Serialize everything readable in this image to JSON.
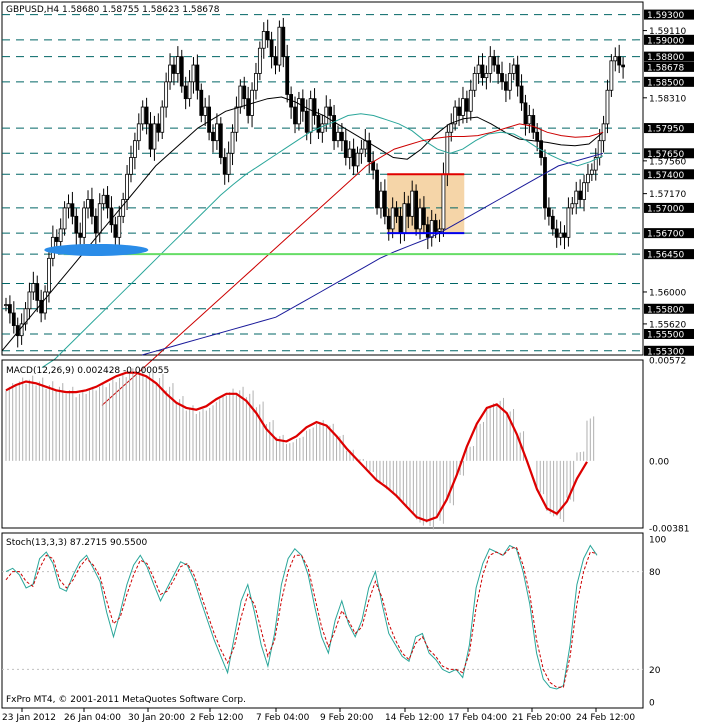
{
  "chart_data": [
    {
      "type": "candlestick",
      "title": "GBPUSD,H4  1.58680 1.58755 1.58623 1.58678",
      "ylim": [
        1.5525,
        1.5945
      ],
      "y_ticks": [
        "1.59300",
        "1.59110",
        "1.59000",
        "1.58800",
        "1.58678",
        "1.58500",
        "1.58310",
        "1.57950",
        "1.57650",
        "1.57560",
        "1.57400",
        "1.57170",
        "1.57000",
        "1.56700",
        "1.56450",
        "1.56000",
        "1.55800",
        "1.55620",
        "1.55500",
        "1.55300"
      ],
      "horizontal_levels": [
        1.593,
        1.59,
        1.588,
        1.585,
        1.5795,
        1.5765,
        1.574,
        1.57,
        1.567,
        1.5645,
        1.561,
        1.558,
        1.555,
        1.553
      ],
      "current_price": 1.58678,
      "highlighted_levels": [
        1.593,
        1.59,
        1.588,
        1.585,
        1.5795,
        1.5765,
        1.574,
        1.57,
        1.567,
        1.5645,
        1.561,
        1.558,
        1.555,
        1.553
      ],
      "close": [
        1.5585,
        1.5575,
        1.556,
        1.5548,
        1.5562,
        1.558,
        1.56,
        1.561,
        1.559,
        1.5575,
        1.56,
        1.564,
        1.5665,
        1.566,
        1.5675,
        1.57,
        1.5705,
        1.569,
        1.567,
        1.5665,
        1.57,
        1.571,
        1.569,
        1.567,
        1.5705,
        1.5715,
        1.57,
        1.568,
        1.5665,
        1.569,
        1.571,
        1.574,
        1.576,
        1.578,
        1.58,
        1.582,
        1.58,
        1.577,
        1.58,
        1.579,
        1.582,
        1.585,
        1.587,
        1.586,
        1.588,
        1.5845,
        1.583,
        1.585,
        1.587,
        1.584,
        1.581,
        1.582,
        1.579,
        1.578,
        1.58,
        1.576,
        1.574,
        1.5765,
        1.579,
        1.582,
        1.5845,
        1.583,
        1.581,
        1.584,
        1.586,
        1.589,
        1.591,
        1.59,
        1.588,
        1.587,
        1.5915,
        1.588,
        1.5835,
        1.582,
        1.58,
        1.583,
        1.5815,
        1.579,
        1.583,
        1.581,
        1.579,
        1.58,
        1.582,
        1.581,
        1.578,
        1.579,
        1.578,
        1.576,
        1.577,
        1.575,
        1.5765,
        1.577,
        1.578,
        1.5755,
        1.5745,
        1.57,
        1.572,
        1.569,
        1.5675,
        1.57,
        1.569,
        1.567,
        1.5705,
        1.569,
        1.572,
        1.5675,
        1.57,
        1.568,
        1.5665,
        1.5685,
        1.5672,
        1.5675,
        1.574,
        1.579,
        1.58,
        1.582,
        1.581,
        1.583,
        1.5815,
        1.584,
        1.586,
        1.587,
        1.5855,
        1.586,
        1.588,
        1.587,
        1.586,
        1.585,
        1.584,
        1.586,
        1.587,
        1.5845,
        1.5825,
        1.58,
        1.581,
        1.579,
        1.578,
        1.576,
        1.57,
        1.569,
        1.5675,
        1.5665,
        1.567,
        1.5665,
        1.57,
        1.5705,
        1.572,
        1.571,
        1.573,
        1.574,
        1.5745,
        1.576,
        1.578,
        1.58,
        1.584,
        1.5875,
        1.588,
        1.587,
        1.58678
      ],
      "overlay_lines": [
        {
          "color": "#000000",
          "values": [
            1.553,
            1.555,
            1.557,
            1.559,
            1.561,
            1.563,
            1.565,
            1.567,
            1.569,
            1.571,
            1.573,
            1.575,
            1.5765,
            1.578,
            1.5795,
            1.5805,
            1.5815,
            1.582,
            1.5825,
            1.583,
            1.5832,
            1.5826,
            1.5817,
            1.581,
            1.58,
            1.579,
            1.578,
            1.577,
            1.576,
            1.5758,
            1.577,
            1.5787,
            1.58,
            1.5806,
            1.5808,
            1.58,
            1.579,
            1.5782,
            1.578,
            1.5778,
            1.5775,
            1.5774,
            1.5776,
            1.579
          ]
        },
        {
          "color": "#2aa69a",
          "values": [
            1.551,
            1.552,
            1.5535,
            1.555,
            1.5565,
            1.558,
            1.5595,
            1.561,
            1.5625,
            1.564,
            1.5655,
            1.567,
            1.5685,
            1.57,
            1.5715,
            1.5728,
            1.574,
            1.575,
            1.576,
            1.577,
            1.578,
            1.579,
            1.5797,
            1.5803,
            1.581,
            1.5812,
            1.581,
            1.5805,
            1.58,
            1.5792,
            1.578,
            1.577,
            1.5765,
            1.577,
            1.578,
            1.5788,
            1.579,
            1.5788,
            1.578,
            1.577,
            1.5762,
            1.5755,
            1.575,
            1.5755,
            1.5762
          ]
        },
        {
          "color": "#cc0000",
          "values": [
            1.5465,
            1.548,
            1.5495,
            1.551,
            1.5525,
            1.554,
            1.5555,
            1.557,
            1.5585,
            1.56,
            1.5615,
            1.563,
            1.5645,
            1.566,
            1.5675,
            1.569,
            1.5705,
            1.572,
            1.5735,
            1.575,
            1.576,
            1.577,
            1.5775,
            1.578,
            1.5783,
            1.5785,
            1.5785,
            1.5786,
            1.579,
            1.5795,
            1.58,
            1.5797,
            1.579,
            1.5786,
            1.5784,
            1.5785,
            1.579
          ]
        },
        {
          "color": "#1a1a9a",
          "values": [
            1.5525,
            1.553,
            1.5535,
            1.554,
            1.5545,
            1.555,
            1.5555,
            1.556,
            1.5565,
            1.557,
            1.558,
            1.559,
            1.56,
            1.561,
            1.562,
            1.563,
            1.564,
            1.5648,
            1.5655,
            1.5662,
            1.567,
            1.568,
            1.569,
            1.57,
            1.571,
            1.572,
            1.573,
            1.574,
            1.575,
            1.5755,
            1.576,
            1.5765
          ]
        }
      ],
      "markers": [
        {
          "kind": "box",
          "x_from": 0.625,
          "x_to": 0.75,
          "y_from": 1.567,
          "y_to": 1.574,
          "color": "#f5d5a8"
        },
        {
          "kind": "segment",
          "x_from": 0.625,
          "x_to": 0.75,
          "y": 1.574,
          "color": "#e00000"
        },
        {
          "kind": "segment",
          "x_from": 0.625,
          "x_to": 0.75,
          "y": 1.567,
          "color": "#0000ee"
        },
        {
          "kind": "segment",
          "x_from": 0.1,
          "x_to": 1.04,
          "y": 1.5645,
          "color": "#66dd66"
        },
        {
          "kind": "ellipse",
          "x": 0.14,
          "y": 1.565,
          "color": "#2a8ce8"
        }
      ]
    },
    {
      "type": "histogram+line",
      "title": "MACD(12,26,9) 0.002428 -0.000055",
      "ylim": [
        -0.00381,
        0.00572
      ],
      "y_ticks": [
        "0.00572",
        "0.00",
        "-0.00381"
      ],
      "histogram": [
        0.0042,
        0.0045,
        0.0046,
        0.0045,
        0.0043,
        0.0042,
        0.004,
        0.0038,
        0.004,
        0.0042,
        0.0044,
        0.0047,
        0.005,
        0.0051,
        0.005,
        0.0047,
        0.0042,
        0.0035,
        0.003,
        0.0028,
        0.003,
        0.0035,
        0.0039,
        0.004,
        0.0038,
        0.0032,
        0.0022,
        0.0014,
        0.001,
        0.0013,
        0.0018,
        0.0022,
        0.002,
        0.0014,
        0.0006,
        0.0001,
        -0.0006,
        -0.0012,
        -0.0017,
        -0.0022,
        -0.0028,
        -0.0035,
        -0.0037,
        -0.0034,
        -0.0024,
        -0.0008,
        0.0008,
        0.0021,
        0.0031,
        0.0034,
        0.0028,
        0.0016,
        0.0,
        -0.0018,
        -0.003,
        -0.0033,
        -0.0022,
        0.0005,
        0.0024
      ],
      "signal": [
        0.004,
        0.0043,
        0.0045,
        0.0044,
        0.0042,
        0.004,
        0.0039,
        0.0039,
        0.004,
        0.0042,
        0.0045,
        0.0048,
        0.005,
        0.005,
        0.0048,
        0.0044,
        0.0038,
        0.0033,
        0.003,
        0.0029,
        0.0031,
        0.0035,
        0.0038,
        0.0038,
        0.0034,
        0.0027,
        0.0018,
        0.0012,
        0.0011,
        0.0014,
        0.0019,
        0.0022,
        0.002,
        0.0014,
        0.0007,
        0.0001,
        -0.0005,
        -0.0011,
        -0.0015,
        -0.002,
        -0.0026,
        -0.0032,
        -0.0034,
        -0.0032,
        -0.0022,
        -0.0008,
        0.0008,
        0.0021,
        0.003,
        0.0032,
        0.0027,
        0.0015,
        0.0,
        -0.0016,
        -0.0027,
        -0.003,
        -0.0023,
        -0.001,
        -5.5e-05
      ]
    },
    {
      "type": "line",
      "title": "Stoch(13,3,3) 87.2715 90.5500",
      "ylim": [
        0,
        100
      ],
      "y_ticks": [
        "100",
        "80",
        "20",
        "0"
      ],
      "series": [
        {
          "color": "#2aa69a",
          "values": [
            80,
            82,
            78,
            70,
            72,
            88,
            92,
            85,
            70,
            68,
            78,
            86,
            90,
            82,
            74,
            55,
            40,
            55,
            72,
            84,
            90,
            83,
            72,
            62,
            70,
            78,
            86,
            84,
            75,
            62,
            50,
            38,
            28,
            18,
            40,
            62,
            72,
            55,
            35,
            22,
            42,
            72,
            88,
            94,
            90,
            78,
            58,
            40,
            30,
            50,
            62,
            48,
            40,
            50,
            70,
            80,
            60,
            42,
            35,
            28,
            25,
            40,
            42,
            30,
            26,
            20,
            18,
            20,
            15,
            35,
            70,
            85,
            94,
            92,
            90,
            96,
            94,
            80,
            60,
            30,
            14,
            9,
            8,
            10,
            35,
            72,
            88,
            96,
            90
          ]
        },
        {
          "color": "#cc0000",
          "values": [
            75,
            80,
            80,
            74,
            71,
            82,
            90,
            88,
            75,
            70,
            75,
            83,
            88,
            84,
            77,
            62,
            48,
            52,
            66,
            78,
            87,
            85,
            76,
            66,
            68,
            75,
            83,
            85,
            78,
            66,
            54,
            42,
            32,
            24,
            34,
            52,
            66,
            60,
            44,
            28,
            38,
            62,
            80,
            90,
            90,
            82,
            64,
            46,
            34,
            44,
            56,
            50,
            42,
            46,
            62,
            74,
            64,
            48,
            38,
            30,
            26,
            36,
            40,
            32,
            28,
            22,
            20,
            20,
            18,
            30,
            58,
            78,
            90,
            92,
            90,
            94,
            95,
            84,
            66,
            38,
            20,
            12,
            9,
            9,
            28,
            60,
            80,
            92,
            91
          ]
        }
      ],
      "levels": [
        80,
        20
      ]
    }
  ],
  "x_ticks": [
    "23 Jan 2012",
    "26 Jan 04:00",
    "30 Jan 20:00",
    "2 Feb 12:00",
    "7 Feb 04:00",
    "9 Feb 20:00",
    "14 Feb 12:00",
    "17 Feb 04:00",
    "21 Feb 20:00",
    "24 Feb 12:00"
  ],
  "copyright": "FxPro MT4, © 2001-2011 MetaQuotes Software Corp.",
  "colors": {
    "grid": "#ffffff",
    "level_line": "#006666",
    "axis": "#000000",
    "candle": "#000000",
    "price_tag": "#000000",
    "macd_line": "#dd0000",
    "macd_hist": "#b0b0b0"
  }
}
